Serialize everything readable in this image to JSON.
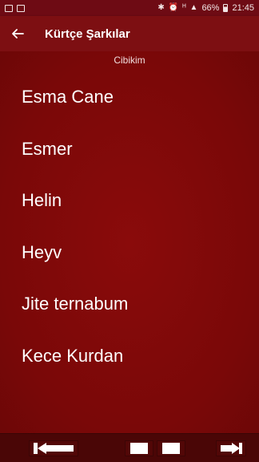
{
  "status_bar": {
    "battery": "66%",
    "time": "21:45",
    "left_icons": [
      "image-icon",
      "notification-icon"
    ],
    "right_icons": [
      "bluetooth-icon",
      "alarm-icon",
      "wifi-icon",
      "signal-icon",
      "battery-icon"
    ]
  },
  "toolbar": {
    "back_icon": "arrow-left-icon",
    "title": "Kürtçe Şarkılar"
  },
  "subtitle": "Cibikim",
  "songs": [
    {
      "label": "Esma Cane"
    },
    {
      "label": "Esmer"
    },
    {
      "label": "Helin"
    },
    {
      "label": "Heyv"
    },
    {
      "label": "Jite ternabum"
    },
    {
      "label": "Kece Kurdan"
    }
  ],
  "player": {
    "controls": [
      "skip-previous-icon",
      "stop-icon",
      "pause-icon",
      "skip-next-icon"
    ]
  },
  "colors": {
    "background": "#7a0a0a",
    "toolbar": "#7d0f12",
    "player_bar": "#4a0606"
  }
}
